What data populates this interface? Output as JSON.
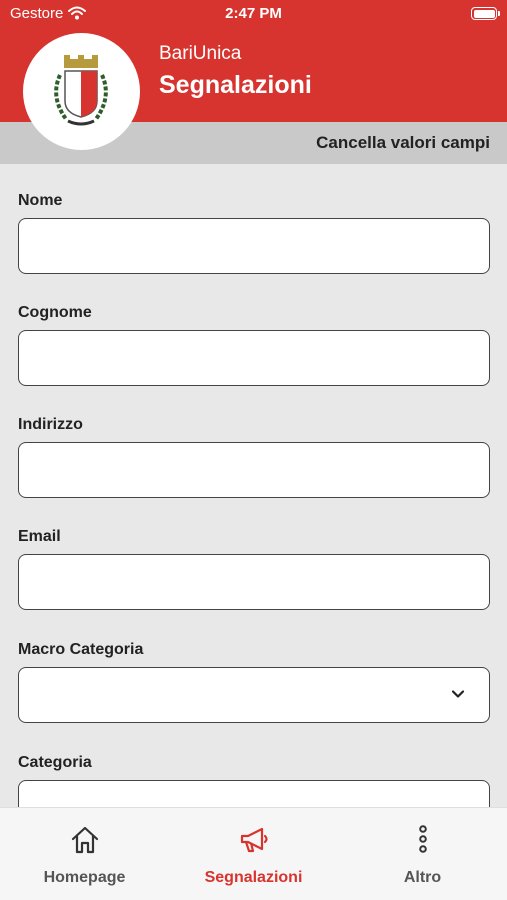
{
  "status_bar": {
    "carrier": "Gestore",
    "time": "2:47 PM"
  },
  "header": {
    "app_name": "BariUnica",
    "title": "Segnalazioni"
  },
  "toolbar": {
    "clear_label": "Cancella valori campi"
  },
  "form": {
    "fields": [
      {
        "label": "Nome",
        "value": ""
      },
      {
        "label": "Cognome",
        "value": ""
      },
      {
        "label": "Indirizzo",
        "value": ""
      },
      {
        "label": "Email",
        "value": ""
      },
      {
        "label": "Macro Categoria",
        "value": "",
        "type": "select"
      },
      {
        "label": "Categoria",
        "value": "",
        "type": "select"
      }
    ]
  },
  "tabbar": {
    "items": [
      {
        "label": "Homepage",
        "icon": "home-icon",
        "active": false
      },
      {
        "label": "Segnalazioni",
        "icon": "megaphone-icon",
        "active": true
      },
      {
        "label": "Altro",
        "icon": "more-vertical-icon",
        "active": false
      }
    ]
  },
  "colors": {
    "brand_red": "#d8342f",
    "subbar_gray": "#c9c9c9",
    "background": "#e8e8e8"
  }
}
